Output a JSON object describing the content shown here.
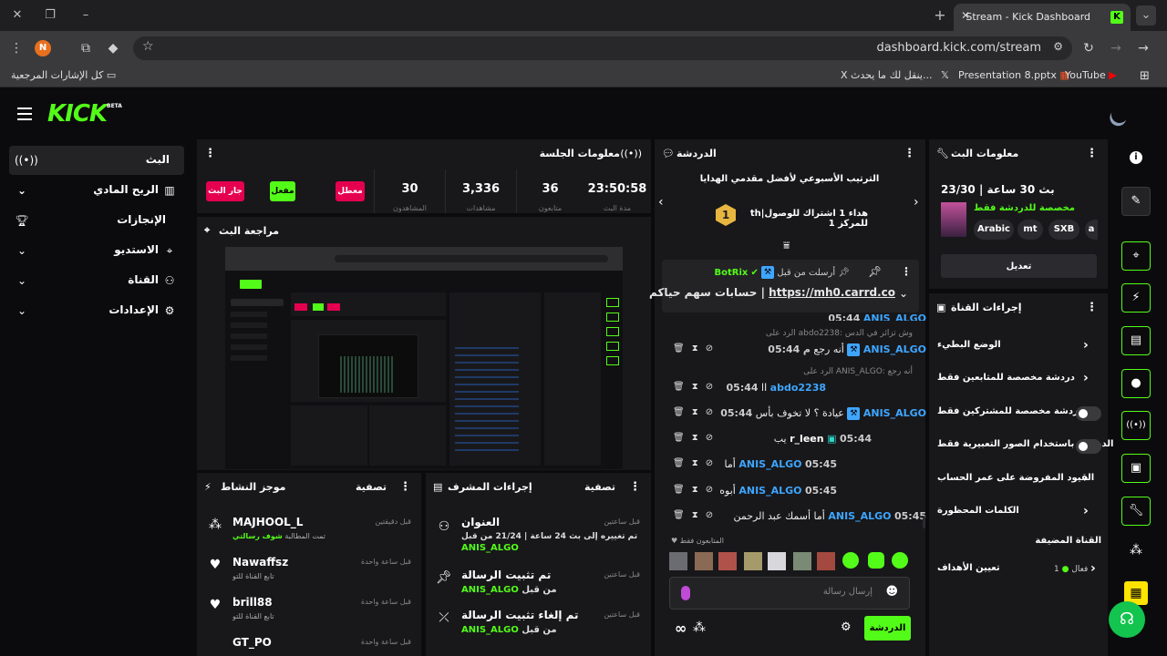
{
  "browser": {
    "tab_title": "Stream - Kick Dashboard",
    "favicon": "K",
    "url": "dashboard.kick.com/stream",
    "profile_initial": "N",
    "bookmarks": {
      "all": "كل الإشارات المرجعية",
      "x_post": "ينقل لك ما يحدث...",
      "presentation": "Presentation 8.pptx",
      "youtube": "YouTube"
    }
  },
  "header": {
    "logo": "KICK",
    "beta": "BETA"
  },
  "sidebar": {
    "items": [
      {
        "label": "البث",
        "icon": "broadcast-icon"
      },
      {
        "label": "الربح المادي",
        "icon": "chart-icon"
      },
      {
        "label": "الإنجازات",
        "icon": "trophy-icon"
      },
      {
        "label": "الاستديو",
        "icon": "focus-icon"
      },
      {
        "label": "القناة",
        "icon": "users-icon"
      },
      {
        "label": "الإعدادات",
        "icon": "gear-icon"
      }
    ]
  },
  "session": {
    "title": "معلومات الجلسة",
    "stats": [
      {
        "value": "23:50:58",
        "label": "مدة البث"
      },
      {
        "value": "36",
        "label": "متابعون"
      },
      {
        "value": "3,336",
        "label": "مشاهدات"
      },
      {
        "value": "30",
        "label": "المشاهدون"
      }
    ],
    "pills": {
      "disabled": "معطل",
      "enabled": "مفعل",
      "live": "جار البث"
    }
  },
  "preview": {
    "title": "مراجعة البث"
  },
  "activity": {
    "title": "موجز النشاط",
    "filter": "تصفية",
    "items": [
      {
        "name": "MAJHOOL_L",
        "sub_prefix": "تمت المطالبة",
        "sub_highlight": "شوف رسالتي",
        "time": "قبل دقيقتين"
      },
      {
        "name": "Nawaffsz",
        "sub": "تابع القناة للتو",
        "time": "قبل ساعة واحدة"
      },
      {
        "name": "brill88",
        "sub": "تابع القناة للتو",
        "time": "قبل ساعة واحدة"
      },
      {
        "name": "GT_PO",
        "sub": "",
        "time": "قبل ساعة واحدة"
      }
    ]
  },
  "modlog": {
    "title": "إجراءات المشرف",
    "filter": "تصفية",
    "items": [
      {
        "title": "العنوان",
        "sub": "تم تغييره إلى بث 24 ساعة | 21/24 من قبل",
        "user": "ANIS_ALGO",
        "time": "قبل ساعتين"
      },
      {
        "title": "تم تثبيت الرسالة",
        "sub": "من قبل",
        "user": "ANIS_ALGO",
        "time": "قبل ساعتين"
      },
      {
        "title": "تم إلغاء تثبيت الرسالة",
        "sub": "من قبل",
        "user": "ANIS_ALGO",
        "time": "قبل ساعتين"
      }
    ]
  },
  "chat": {
    "title": "الدردشة",
    "leaderboard_title": "الترتيب الأسبوعي لأفضل مقدمي الهدايا",
    "leaderboard_line": "th|هداء 1 اشتراك للوصول للمركز 1",
    "rank": "1",
    "pinned": {
      "user": "BotRix",
      "sent_by": "أرسلت من قبل",
      "link": "https://mh0.carrd.co",
      "text": "حسابات سهم حياكم |"
    },
    "messages": [
      {
        "type": "partial",
        "ts": "05:44",
        "user": "ANIS_ALGO",
        "text": ""
      },
      {
        "type": "reply",
        "text": "الرد على abdo2238: وش تزائر في الدس"
      },
      {
        "type": "msg",
        "ts": "05:44",
        "user": "ANIS_ALGO",
        "text": "أنه رجع"
      },
      {
        "type": "reply",
        "text": "الرد على ANIS_ALGO: أنه رجع"
      },
      {
        "type": "msg",
        "ts": "05:44",
        "user": "abdo2238",
        "text": "اا"
      },
      {
        "type": "msg",
        "ts": "05:44",
        "user": "ANIS_ALGO",
        "text": "عيادة ؟ لا تخوف بأس"
      },
      {
        "type": "msg",
        "ts": "05:44",
        "user": "r_leen",
        "text": "يب"
      },
      {
        "type": "msg",
        "ts": "05:45",
        "user": "ANIS_ALGO",
        "text": "أما"
      },
      {
        "type": "msg",
        "ts": "05:45",
        "user": "ANIS_ALGO",
        "text": "أبوه"
      },
      {
        "type": "msg",
        "ts": "05:45",
        "user": "ANIS_ALGO",
        "text": "أما أسمك عبد الرحمن"
      }
    ],
    "followers_only": "المتابعون فقط",
    "input_placeholder": "إرسال رسالة",
    "send_label": "الدردشة"
  },
  "stream_info": {
    "title": "معلومات البث",
    "stream_title": "بث 30 ساعة | 23/30",
    "subtitle": "مخصصة للدردشة فقط",
    "tags": [
      "Arabic",
      "mt",
      "SXB",
      "a"
    ],
    "edit_label": "تعديل"
  },
  "channel_actions": {
    "title": "إجراءات القناة",
    "rows": [
      {
        "label": "الوضع البطيء",
        "control": "chevron"
      },
      {
        "label": "دردشة مخصصة للمتابعين فقط",
        "control": "chevron"
      },
      {
        "label": "الدردشة مخصصة للمشتركين فقط",
        "control": "toggle"
      },
      {
        "label": "الدردشة باستخدام الصور التعبيرية فقط",
        "control": "toggle"
      },
      {
        "label": "القيود المفروضة على عمر الحساب",
        "control": "chevron"
      },
      {
        "label": "الكلمات المحظورة",
        "control": "chevron"
      }
    ],
    "featured": "القناة المضيفة",
    "goals": "تعيين الأهداف",
    "goals_status": "فعال",
    "goals_count": "1"
  },
  "colors": {
    "accent": "#53fc18",
    "username": "#3ea6ff",
    "danger": "#e5004f",
    "panel": "#18181b"
  }
}
